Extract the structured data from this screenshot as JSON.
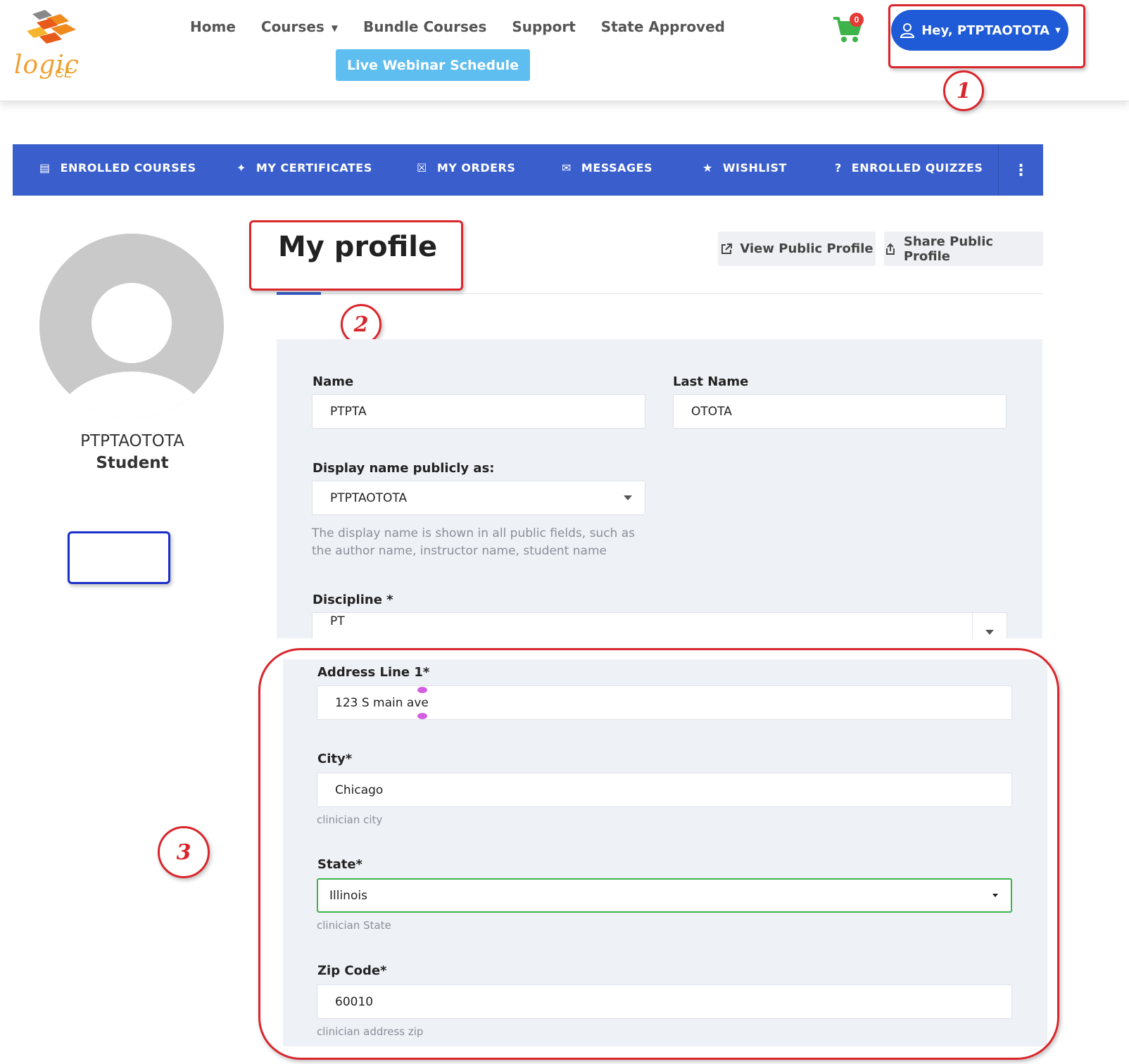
{
  "header": {
    "logo_text": "logic",
    "logo_sub": "CE",
    "nav": {
      "home": "Home",
      "courses": "Courses",
      "bundle": "Bundle Courses",
      "support": "Support",
      "state": "State Approved"
    },
    "webinar_label": "Live Webinar Schedule",
    "cart_count": "0",
    "user_label": "Hey, PTPTAOTOTA"
  },
  "tabs": {
    "enrolled_courses": "ENROLLED COURSES",
    "certificates": "MY CERTIFICATES",
    "orders": "MY ORDERS",
    "messages": "MESSAGES",
    "wishlist": "WISHLIST",
    "quizzes": "ENROLLED QUIZZES"
  },
  "profile": {
    "username": "PTPTAOTOTA",
    "role": "Student"
  },
  "page": {
    "title": "My profile",
    "view_public": "View Public Profile",
    "share_public": "Share Public Profile"
  },
  "form": {
    "name_label": "Name",
    "name_value": "PTPTA",
    "last_name_label": "Last Name",
    "last_name_value": "OTOTA",
    "display_label": "Display name publicly as:",
    "display_value": "PTPTAOTOTA",
    "display_help": "The display name is shown in all public fields, such as the author name, instructor name, student name",
    "discipline_label": "Discipline *",
    "discipline_value": "PT",
    "address_label": "Address Line 1*",
    "address_value": "123 S main ave",
    "city_label": "City*",
    "city_value": "Chicago",
    "city_help": "clinician city",
    "state_label": "State*",
    "state_value": "Illinois",
    "state_help": "clinician State",
    "zip_label": "Zip Code*",
    "zip_value": "60010",
    "zip_help": "clinician address zip"
  },
  "annotations": {
    "one": "1",
    "two": "2",
    "three": "3"
  },
  "colors": {
    "brand_blue": "#3a5fcd",
    "user_button": "#1f5bd6",
    "webinar_button": "#5fbef0",
    "annotation_red": "#d9262c",
    "cart_green": "#3db34a"
  }
}
